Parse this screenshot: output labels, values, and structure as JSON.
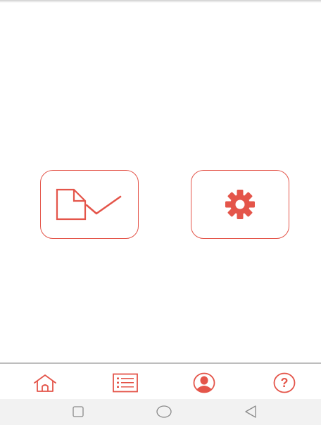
{
  "colors": {
    "accent": "#e4554a",
    "nav_divider": "#bdbdbd",
    "system_bar_bg": "#f2f2f2",
    "system_icon": "#8a8a8a"
  },
  "main": {
    "tiles": [
      {
        "icon": "document-check-icon"
      },
      {
        "icon": "gear-icon"
      }
    ]
  },
  "bottom_nav": {
    "items": [
      {
        "icon": "home-icon"
      },
      {
        "icon": "list-icon"
      },
      {
        "icon": "profile-icon",
        "active": true
      },
      {
        "icon": "help-icon",
        "glyph": "?"
      }
    ]
  },
  "system_nav": {
    "buttons": [
      {
        "icon": "recents-square-icon"
      },
      {
        "icon": "home-circle-icon"
      },
      {
        "icon": "back-triangle-icon"
      }
    ]
  }
}
